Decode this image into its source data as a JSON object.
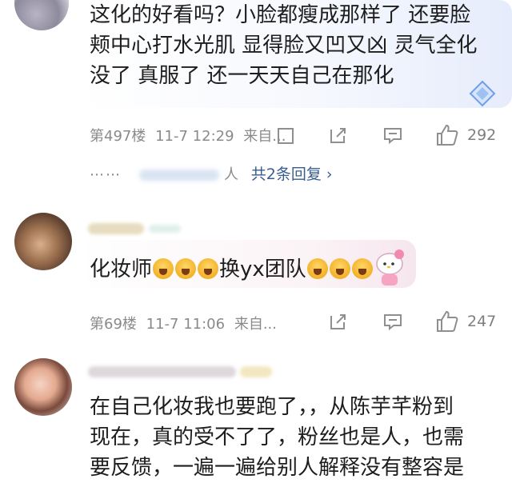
{
  "comments": [
    {
      "text_lines": [
        "这化的好看吗？小脸都瘦成那样了 还要脸",
        "颊中心打水光肌 显得脸又凹又凶 灵气全化",
        "没了 真服了 还一天天自己在那化"
      ],
      "floor": "第497楼",
      "time": "11-7 12:29",
      "source": "来自...",
      "likes": "292",
      "reply_suffix": "人",
      "reply_link": "共2条回复 ›"
    },
    {
      "text_pre": "化妆师",
      "text_mid": "换yx团队",
      "floor": "第69楼",
      "time": "11-7 11:06",
      "source": "来自...",
      "likes": "247"
    },
    {
      "text_lines": [
        "在自己化妆我也要跑了，，从陈芋芊粉到",
        "现在，真的受不了了，粉丝也是人，也需",
        "要反馈，一遍一遍给别人解释没有整容是"
      ]
    }
  ],
  "icons": [
    "comment-icon",
    "share-icon",
    "reply-icon",
    "like-icon",
    "badge-icon"
  ]
}
